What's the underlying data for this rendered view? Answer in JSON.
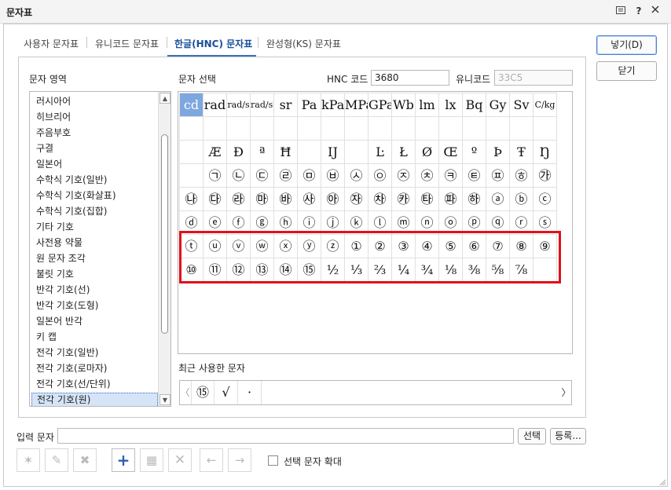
{
  "window": {
    "title": "문자표"
  },
  "tabs": [
    {
      "label": "사용자 문자표"
    },
    {
      "label": "유니코드 문자표"
    },
    {
      "label": "한글(HNC) 문자표"
    },
    {
      "label": "완성형(KS) 문자표"
    }
  ],
  "buttons": {
    "insert": "넣기(D)",
    "close": "닫기",
    "select": "선택",
    "register": "등록..."
  },
  "area": {
    "label": "문자 영역",
    "items": [
      "러시아어",
      "히브리어",
      "주음부호",
      "구결",
      "일본어",
      "수학식 기호(일반)",
      "수학식 기호(화살표)",
      "수학식 기호(집합)",
      "기타 기호",
      "사전용 약물",
      "원 문자 조각",
      "불릿 기호",
      "반각 기호(선)",
      "반각 기호(도형)",
      "일본어 반각",
      "키 캡",
      "전각 기호(일반)",
      "전각 기호(로마자)",
      "전각 기호(선/단위)",
      "전각 기호(원)"
    ],
    "selected_index": 19
  },
  "selection": {
    "label": "문자 선택",
    "hnc_label": "HNC 코드",
    "hnc_value": "3680",
    "unicode_label": "유니코드",
    "unicode_value": "33C5"
  },
  "grid": {
    "rows": [
      [
        "cd",
        "rad",
        "rad/s",
        "rad/s²",
        "sr",
        "Pa",
        "kPa",
        "MPa",
        "GPa",
        "Wb",
        "lm",
        "lx",
        "Bq",
        "Gy",
        "Sv",
        "C/kg"
      ],
      [
        "",
        "",
        "",
        "",
        "",
        "",
        "",
        "",
        "",
        "",
        "",
        "",
        "",
        "",
        "",
        ""
      ],
      [
        "",
        "Æ",
        "Ð",
        "ª",
        "Ħ",
        "",
        "Ĳ",
        "",
        "Ŀ",
        "Ł",
        "Ø",
        "Œ",
        "º",
        "Þ",
        "Ŧ",
        "Ŋ"
      ],
      [
        "",
        "㉠",
        "㉡",
        "㉢",
        "㉣",
        "㉤",
        "㉥",
        "㉦",
        "㉧",
        "㉨",
        "㉩",
        "㉪",
        "㉫",
        "㉬",
        "㉭",
        "㉮"
      ],
      [
        "㉯",
        "㉰",
        "㉱",
        "㉲",
        "㉳",
        "㉴",
        "㉵",
        "㉶",
        "㉷",
        "㉸",
        "㉹",
        "㉺",
        "㉻",
        "ⓐ",
        "ⓑ",
        "ⓒ"
      ],
      [
        "ⓓ",
        "ⓔ",
        "ⓕ",
        "ⓖ",
        "ⓗ",
        "ⓘ",
        "ⓙ",
        "ⓚ",
        "ⓛ",
        "ⓜ",
        "ⓝ",
        "ⓞ",
        "ⓟ",
        "ⓠ",
        "ⓡ",
        "ⓢ"
      ],
      [
        "ⓣ",
        "ⓤ",
        "ⓥ",
        "ⓦ",
        "ⓧ",
        "ⓨ",
        "ⓩ",
        "①",
        "②",
        "③",
        "④",
        "⑤",
        "⑥",
        "⑦",
        "⑧",
        "⑨"
      ],
      [
        "⑩",
        "⑪",
        "⑫",
        "⑬",
        "⑭",
        "⑮",
        "½",
        "⅓",
        "⅔",
        "¼",
        "¾",
        "⅛",
        "⅜",
        "⅝",
        "⅞",
        ""
      ]
    ],
    "selected": "cd"
  },
  "recent": {
    "label": "최근 사용한 문자",
    "items": [
      "⑮",
      "√",
      "·"
    ],
    "prev": "〈",
    "next": "〉"
  },
  "input": {
    "label": "입력 문자",
    "value": ""
  },
  "options": {
    "enlarge_label": "선택 문자 확대",
    "enlarge_checked": false
  },
  "colors": {
    "accent": "#1a4f9c",
    "highlight": "#e0101a",
    "selected_cell": "#7ea7e0"
  }
}
